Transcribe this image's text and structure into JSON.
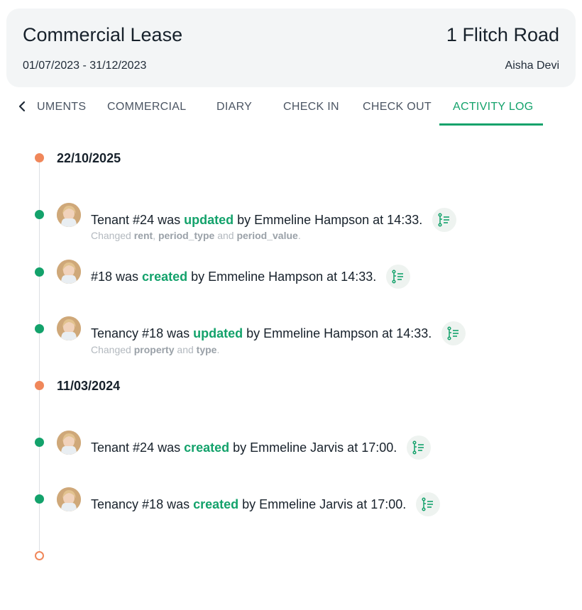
{
  "header": {
    "title": "Commercial Lease",
    "address": "1 Flitch Road",
    "dates": "01/07/2023 - 31/12/2023",
    "person": "Aisha Devi"
  },
  "tabs": [
    {
      "label": "UMENTS"
    },
    {
      "label": "COMMERCIAL"
    },
    {
      "label": "DIARY"
    },
    {
      "label": "CHECK IN"
    },
    {
      "label": "CHECK OUT"
    },
    {
      "label": "ACTIVITY LOG",
      "active": true
    }
  ],
  "groups": [
    {
      "date": "22/10/2025",
      "entries": [
        {
          "pre": "Tenant #24 was",
          "verb": "updated",
          "post": "by Emmeline Hampson at 14:33.",
          "changes": {
            "prefix": "Changed",
            "fields": [
              "rent",
              "period_type",
              "period_value"
            ],
            "sep1": ",",
            "sep2": "and",
            "end": "."
          }
        },
        {
          "pre": "#18 was",
          "verb": "created",
          "post": "by Emmeline Hampson at 14:33."
        },
        {
          "pre": "Tenancy #18 was",
          "verb": "updated",
          "post": "by Emmeline Hampson at 14:33.",
          "changes": {
            "prefix": "Changed",
            "fields": [
              "property",
              "type"
            ],
            "sep2": "and",
            "end": "."
          }
        }
      ]
    },
    {
      "date": "11/03/2024",
      "entries": [
        {
          "pre": "Tenant #24 was",
          "verb": "created",
          "post": "by Emmeline Jarvis at 17:00."
        },
        {
          "pre": "Tenancy #18 was",
          "verb": "created",
          "post": "by Emmeline Jarvis at 17:00."
        }
      ]
    }
  ],
  "icons": {
    "tab_prev": "chevron-left-icon",
    "details": "list-tree-icon"
  },
  "colors": {
    "accent": "#13a26b",
    "date_dot": "#f0875a"
  }
}
